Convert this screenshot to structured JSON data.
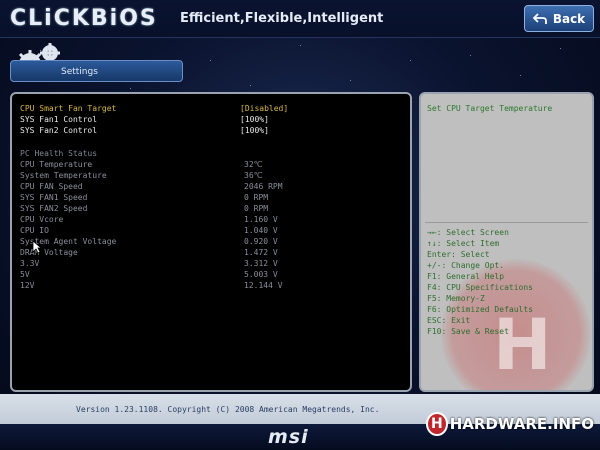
{
  "header": {
    "logo": "CLiCKBiOS",
    "tagline": "Efficient,Flexible,Intelligent",
    "back_label": "Back"
  },
  "nav": {
    "settings_label": "Settings"
  },
  "settings": [
    {
      "label": "CPU Smart Fan Target",
      "value": "[Disabled]",
      "highlight": true
    },
    {
      "label": "SYS Fan1 Control",
      "value": "[100%]",
      "highlight": false
    },
    {
      "label": "SYS Fan2 Control",
      "value": "[100%]",
      "highlight": false
    }
  ],
  "health": {
    "title": "PC Health Status",
    "items": [
      {
        "label": "CPU Temperature",
        "value": "32℃"
      },
      {
        "label": "System Temperature",
        "value": "36℃"
      },
      {
        "label": "CPU FAN Speed",
        "value": "2046 RPM"
      },
      {
        "label": "SYS FAN1 Speed",
        "value": "0 RPM"
      },
      {
        "label": "SYS FAN2 Speed",
        "value": "0 RPM"
      },
      {
        "label": "CPU Vcore",
        "value": "1.160 V"
      },
      {
        "label": "CPU IO",
        "value": "1.040 V"
      },
      {
        "label": "System Agent Voltage",
        "value": "0.920 V"
      },
      {
        "label": "DRAM Voltage",
        "value": "1.472 V"
      },
      {
        "label": "3.3V",
        "value": "3.312 V"
      },
      {
        "label": "5V",
        "value": "5.003 V"
      },
      {
        "label": "12V",
        "value": "12.144 V"
      }
    ]
  },
  "help": {
    "title": "Set CPU Target Temperature",
    "keys": [
      "→←: Select Screen",
      "↑↓: Select Item",
      "Enter: Select",
      "+/-: Change Opt.",
      "F1: General Help",
      "F4: CPU Specifications",
      "F5: Memory-Z",
      "F6: Optimized Defaults",
      "ESC: Exit",
      "F10: Save & Reset"
    ]
  },
  "footer": {
    "version": "Version 1.23.1108. Copyright (C) 2008 American Megatrends, Inc.",
    "brand": "msi",
    "watermark": "HARDWARE.INFO",
    "watermark_letter": "H"
  },
  "icons": {
    "back": "back-arrow-icon",
    "settings": "gear-icon",
    "cursor": "mouse-cursor-icon"
  },
  "colors": {
    "accent": "#2d5a9b",
    "highlight_text": "#d9b84a",
    "help_text": "#2e6f2e",
    "panel_bg": "#000000"
  }
}
